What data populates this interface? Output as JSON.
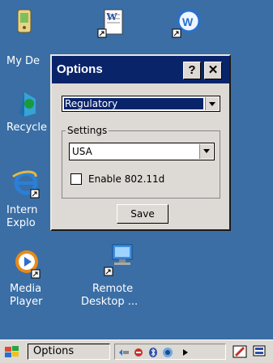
{
  "desktop": {
    "icons": [
      {
        "label": "My De",
        "label2": ""
      },
      {
        "label": "Recycle",
        "label2": ""
      },
      {
        "label": "Intern",
        "label2": "Explo"
      },
      {
        "label": "Media",
        "label2": "Player"
      },
      {
        "label": "Remote",
        "label2": "Desktop ..."
      }
    ]
  },
  "dialog": {
    "title": "Options",
    "help_label": "?",
    "close_label": "✕",
    "category_select": "Regulatory",
    "settings_group_label": "Settings",
    "country_select": "USA",
    "checkbox_label": "Enable 802.11d",
    "checkbox_checked": false,
    "save_label": "Save"
  },
  "taskbar": {
    "task_button_label": "Options"
  },
  "colors": {
    "desktop": "#3a6ea5",
    "titlebar": "#0a246a",
    "selection": "#0a246a",
    "chrome": "#ddd9d4"
  }
}
